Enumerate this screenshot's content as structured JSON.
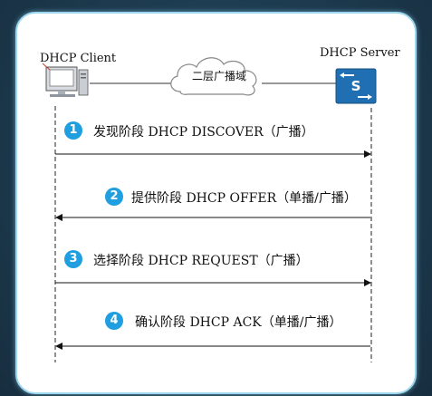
{
  "client": {
    "label": "DHCP Client",
    "icon": "computer-icon"
  },
  "server": {
    "label": "DHCP Server",
    "icon": "switch-icon"
  },
  "network": {
    "label": "二层广播域",
    "icon": "cloud-icon"
  },
  "steps": [
    {
      "number": "1",
      "text": "发现阶段 DHCP DISCOVER（广播）",
      "direction": "client-to-server"
    },
    {
      "number": "2",
      "text": "提供阶段 DHCP OFFER（单播/广播）",
      "direction": "server-to-client"
    },
    {
      "number": "3",
      "text": "选择阶段 DHCP REQUEST（广播）",
      "direction": "client-to-server"
    },
    {
      "number": "4",
      "text": "确认阶段 DHCP ACK（单播/广播）",
      "direction": "server-to-client"
    }
  ],
  "colors": {
    "badge": "#1f9ee0",
    "switch": "#1f6fb2",
    "card_border": "#9fd7ee",
    "background": "#1c3a4f"
  }
}
